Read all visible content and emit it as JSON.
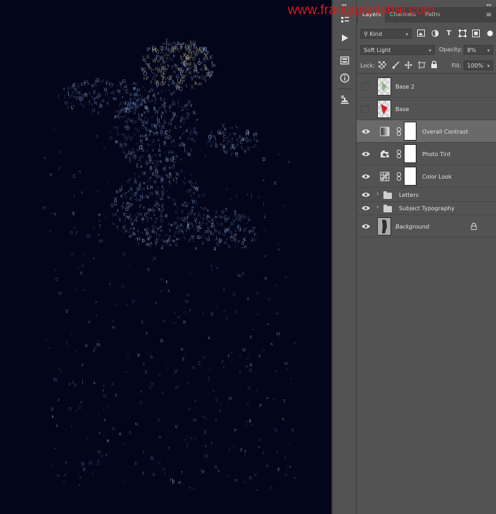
{
  "watermark": "www.frangipanishal.com",
  "tabs": [
    {
      "label": "Layers",
      "active": true
    },
    {
      "label": "Channels",
      "active": false
    },
    {
      "label": "Paths",
      "active": false
    }
  ],
  "filter": {
    "kind_label": "Kind",
    "icons": [
      "pixel-filter-icon",
      "adjustment-filter-icon",
      "type-filter-icon",
      "shape-filter-icon",
      "smart-object-filter-icon",
      "filter-toggle-icon"
    ]
  },
  "blend": {
    "mode": "Soft Light",
    "opacity_label": "Opacity:",
    "opacity_value": "8%"
  },
  "lock": {
    "label": "Lock:",
    "fill_label": "Fill:",
    "fill_value": "100%"
  },
  "layers": [
    {
      "name": "Base 2",
      "visible": false,
      "type": "pixel"
    },
    {
      "name": "Base",
      "visible": false,
      "type": "pixel"
    },
    {
      "name": "Overall Contrast",
      "visible": true,
      "type": "gradient-map",
      "selected": true
    },
    {
      "name": "Photo Tint",
      "visible": true,
      "type": "photo-filter"
    },
    {
      "name": "Color Look",
      "visible": true,
      "type": "color-lookup"
    },
    {
      "name": "Letters",
      "visible": true,
      "type": "group"
    },
    {
      "name": "Subject Typography",
      "visible": true,
      "type": "group"
    },
    {
      "name": "Background",
      "visible": true,
      "type": "background",
      "locked": true
    }
  ],
  "tools": [
    "play-icon",
    "history-icon",
    "info-icon",
    "clone-source-icon"
  ],
  "colors": {
    "canvas_bg": "#03051a",
    "panel_bg": "#535353",
    "selected_row": "#6a6a6a",
    "watermark": "#d21a1a"
  }
}
